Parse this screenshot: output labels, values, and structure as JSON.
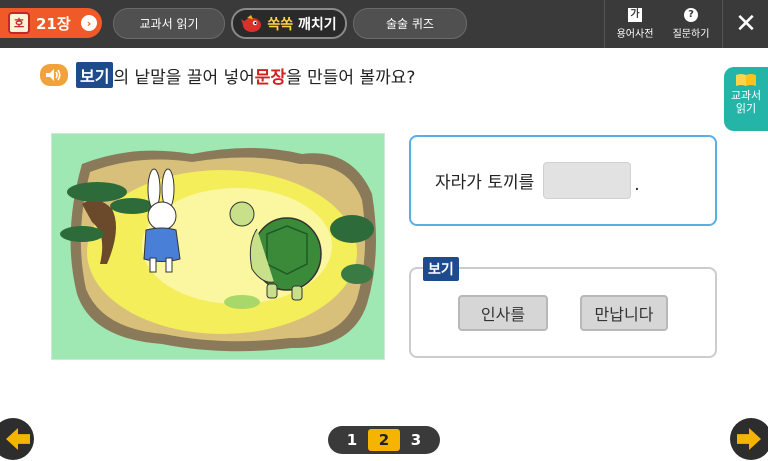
{
  "header": {
    "chapter_label": "21장",
    "chapter_seal": "호",
    "chapter_arrow": "›",
    "tabs": [
      {
        "label": "교과서 읽기"
      },
      {
        "label_a": "쏙쏙",
        "label_b": "깨치기"
      },
      {
        "label": "술술 퀴즈"
      }
    ],
    "dictionary_label": "용어사전",
    "dictionary_icon": "가",
    "help_label": "질문하기",
    "help_icon": "?",
    "close_icon": "✕"
  },
  "question": {
    "tag": "보기",
    "text_a": "의 낱말을 끌어 넣어 ",
    "text_red": "문장",
    "text_b": "을 만들어 볼까요?"
  },
  "side_tab": {
    "line1": "교과서",
    "line2": "읽기"
  },
  "sentence": {
    "text": "자라가 토끼를",
    "period": "."
  },
  "example": {
    "tag": "보기",
    "words": [
      "인사를",
      "만납니다"
    ]
  },
  "pager": {
    "pages": [
      "1",
      "2",
      "3"
    ],
    "current": "2"
  }
}
